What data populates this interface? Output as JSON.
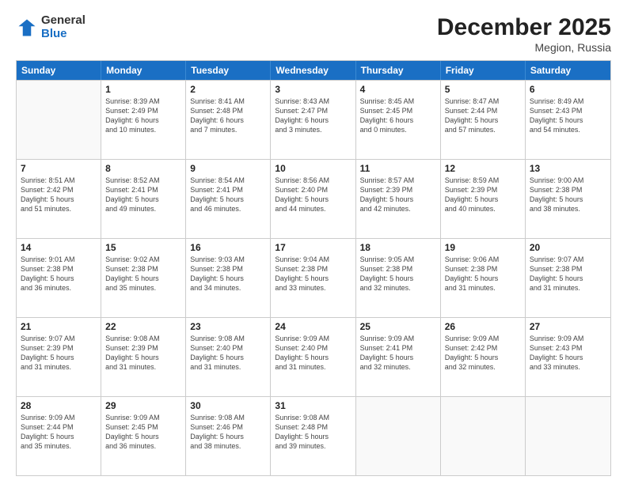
{
  "header": {
    "logo": {
      "line1": "General",
      "line2": "Blue"
    },
    "title": "December 2025",
    "subtitle": "Megion, Russia"
  },
  "calendar": {
    "days": [
      "Sunday",
      "Monday",
      "Tuesday",
      "Wednesday",
      "Thursday",
      "Friday",
      "Saturday"
    ],
    "weeks": [
      [
        {
          "day": "",
          "info": ""
        },
        {
          "day": "1",
          "info": "Sunrise: 8:39 AM\nSunset: 2:49 PM\nDaylight: 6 hours\nand 10 minutes."
        },
        {
          "day": "2",
          "info": "Sunrise: 8:41 AM\nSunset: 2:48 PM\nDaylight: 6 hours\nand 7 minutes."
        },
        {
          "day": "3",
          "info": "Sunrise: 8:43 AM\nSunset: 2:47 PM\nDaylight: 6 hours\nand 3 minutes."
        },
        {
          "day": "4",
          "info": "Sunrise: 8:45 AM\nSunset: 2:45 PM\nDaylight: 6 hours\nand 0 minutes."
        },
        {
          "day": "5",
          "info": "Sunrise: 8:47 AM\nSunset: 2:44 PM\nDaylight: 5 hours\nand 57 minutes."
        },
        {
          "day": "6",
          "info": "Sunrise: 8:49 AM\nSunset: 2:43 PM\nDaylight: 5 hours\nand 54 minutes."
        }
      ],
      [
        {
          "day": "7",
          "info": "Sunrise: 8:51 AM\nSunset: 2:42 PM\nDaylight: 5 hours\nand 51 minutes."
        },
        {
          "day": "8",
          "info": "Sunrise: 8:52 AM\nSunset: 2:41 PM\nDaylight: 5 hours\nand 49 minutes."
        },
        {
          "day": "9",
          "info": "Sunrise: 8:54 AM\nSunset: 2:41 PM\nDaylight: 5 hours\nand 46 minutes."
        },
        {
          "day": "10",
          "info": "Sunrise: 8:56 AM\nSunset: 2:40 PM\nDaylight: 5 hours\nand 44 minutes."
        },
        {
          "day": "11",
          "info": "Sunrise: 8:57 AM\nSunset: 2:39 PM\nDaylight: 5 hours\nand 42 minutes."
        },
        {
          "day": "12",
          "info": "Sunrise: 8:59 AM\nSunset: 2:39 PM\nDaylight: 5 hours\nand 40 minutes."
        },
        {
          "day": "13",
          "info": "Sunrise: 9:00 AM\nSunset: 2:38 PM\nDaylight: 5 hours\nand 38 minutes."
        }
      ],
      [
        {
          "day": "14",
          "info": "Sunrise: 9:01 AM\nSunset: 2:38 PM\nDaylight: 5 hours\nand 36 minutes."
        },
        {
          "day": "15",
          "info": "Sunrise: 9:02 AM\nSunset: 2:38 PM\nDaylight: 5 hours\nand 35 minutes."
        },
        {
          "day": "16",
          "info": "Sunrise: 9:03 AM\nSunset: 2:38 PM\nDaylight: 5 hours\nand 34 minutes."
        },
        {
          "day": "17",
          "info": "Sunrise: 9:04 AM\nSunset: 2:38 PM\nDaylight: 5 hours\nand 33 minutes."
        },
        {
          "day": "18",
          "info": "Sunrise: 9:05 AM\nSunset: 2:38 PM\nDaylight: 5 hours\nand 32 minutes."
        },
        {
          "day": "19",
          "info": "Sunrise: 9:06 AM\nSunset: 2:38 PM\nDaylight: 5 hours\nand 31 minutes."
        },
        {
          "day": "20",
          "info": "Sunrise: 9:07 AM\nSunset: 2:38 PM\nDaylight: 5 hours\nand 31 minutes."
        }
      ],
      [
        {
          "day": "21",
          "info": "Sunrise: 9:07 AM\nSunset: 2:39 PM\nDaylight: 5 hours\nand 31 minutes."
        },
        {
          "day": "22",
          "info": "Sunrise: 9:08 AM\nSunset: 2:39 PM\nDaylight: 5 hours\nand 31 minutes."
        },
        {
          "day": "23",
          "info": "Sunrise: 9:08 AM\nSunset: 2:40 PM\nDaylight: 5 hours\nand 31 minutes."
        },
        {
          "day": "24",
          "info": "Sunrise: 9:09 AM\nSunset: 2:40 PM\nDaylight: 5 hours\nand 31 minutes."
        },
        {
          "day": "25",
          "info": "Sunrise: 9:09 AM\nSunset: 2:41 PM\nDaylight: 5 hours\nand 32 minutes."
        },
        {
          "day": "26",
          "info": "Sunrise: 9:09 AM\nSunset: 2:42 PM\nDaylight: 5 hours\nand 32 minutes."
        },
        {
          "day": "27",
          "info": "Sunrise: 9:09 AM\nSunset: 2:43 PM\nDaylight: 5 hours\nand 33 minutes."
        }
      ],
      [
        {
          "day": "28",
          "info": "Sunrise: 9:09 AM\nSunset: 2:44 PM\nDaylight: 5 hours\nand 35 minutes."
        },
        {
          "day": "29",
          "info": "Sunrise: 9:09 AM\nSunset: 2:45 PM\nDaylight: 5 hours\nand 36 minutes."
        },
        {
          "day": "30",
          "info": "Sunrise: 9:08 AM\nSunset: 2:46 PM\nDaylight: 5 hours\nand 38 minutes."
        },
        {
          "day": "31",
          "info": "Sunrise: 9:08 AM\nSunset: 2:48 PM\nDaylight: 5 hours\nand 39 minutes."
        },
        {
          "day": "",
          "info": ""
        },
        {
          "day": "",
          "info": ""
        },
        {
          "day": "",
          "info": ""
        }
      ]
    ]
  }
}
